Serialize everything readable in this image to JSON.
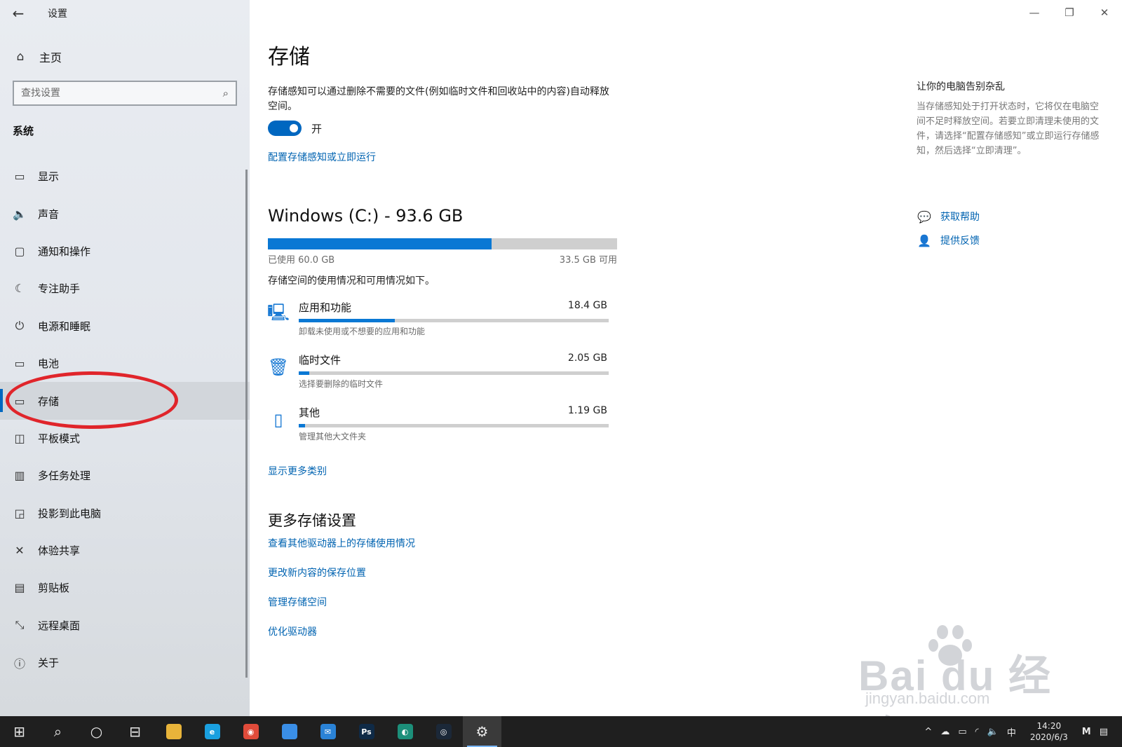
{
  "window": {
    "back_glyph": "←",
    "title": "设置",
    "controls": {
      "minimize": "—",
      "restore": "❐",
      "close": "✕"
    }
  },
  "sidebar": {
    "home_label": "主页",
    "search_placeholder": "查找设置",
    "section": "系统",
    "items": [
      {
        "label": "显示",
        "icon": "display-icon",
        "glyph": "▭"
      },
      {
        "label": "声音",
        "icon": "speaker-icon",
        "glyph": "🔈"
      },
      {
        "label": "通知和操作",
        "icon": "notification-icon",
        "glyph": "▢"
      },
      {
        "label": "专注助手",
        "icon": "moon-icon",
        "glyph": "☾"
      },
      {
        "label": "电源和睡眠",
        "icon": "power-icon",
        "glyph": "⏻"
      },
      {
        "label": "电池",
        "icon": "battery-icon",
        "glyph": "▭"
      },
      {
        "label": "存储",
        "icon": "storage-icon",
        "glyph": "▭"
      },
      {
        "label": "平板模式",
        "icon": "tablet-icon",
        "glyph": "◫"
      },
      {
        "label": "多任务处理",
        "icon": "multitask-icon",
        "glyph": "▥"
      },
      {
        "label": "投影到此电脑",
        "icon": "project-icon",
        "glyph": "◲"
      },
      {
        "label": "体验共享",
        "icon": "share-icon",
        "glyph": "✕"
      },
      {
        "label": "剪贴板",
        "icon": "clipboard-icon",
        "glyph": "▤"
      },
      {
        "label": "远程桌面",
        "icon": "remote-icon",
        "glyph": "⤡"
      },
      {
        "label": "关于",
        "icon": "info-icon",
        "glyph": "ⓘ"
      }
    ],
    "active_index": 6
  },
  "main": {
    "title": "存储",
    "sense_description": "存储感知可以通过删除不需要的文件(例如临时文件和回收站中的内容)自动释放空间。",
    "toggle_label": "开",
    "toggle_on": true,
    "config_link": "配置存储感知或立即运行",
    "drive": {
      "title": "Windows (C:) - 93.6 GB",
      "used_label": "已使用 60.0 GB",
      "free_label": "33.5 GB 可用",
      "used_fraction": 0.641
    },
    "usage_intro": "存储空间的使用情况和可用情况如下。",
    "categories": [
      {
        "name": "应用和功能",
        "size": "18.4 GB",
        "desc": "卸载未使用或不想要的应用和功能",
        "icon": "monitor-icon",
        "glyph": "🖳",
        "fraction": 0.31
      },
      {
        "name": "临时文件",
        "size": "2.05 GB",
        "desc": "选择要删除的临时文件",
        "icon": "trash-icon",
        "glyph": "🗑",
        "fraction": 0.035
      },
      {
        "name": "其他",
        "size": "1.19 GB",
        "desc": "管理其他大文件夹",
        "icon": "folder-icon",
        "glyph": "▯",
        "fraction": 0.02
      }
    ],
    "show_more": "显示更多类别",
    "more_settings_title": "更多存储设置",
    "more_links": [
      "查看其他驱动器上的存储使用情况",
      "更改新内容的保存位置",
      "管理存储空间",
      "优化驱动器"
    ]
  },
  "side_panel": {
    "title": "让你的电脑告别杂乱",
    "description": "当存储感知处于打开状态时，它将仅在电脑空间不足时释放空间。若要立即清理未使用的文件，请选择“配置存储感知”或立即运行存储感知，然后选择“立即清理”。",
    "help_link": "获取帮助",
    "feedback_link": "提供反馈"
  },
  "watermark": {
    "logo": "Bai  du 经验",
    "url": "jingyan.baidu.com"
  },
  "taskbar": {
    "apps": [
      {
        "name": "start-button",
        "glyph": "⊞"
      },
      {
        "name": "search-icon",
        "glyph": "⌕"
      },
      {
        "name": "cortana-icon",
        "glyph": "○"
      },
      {
        "name": "task-view-icon",
        "glyph": "⊟"
      },
      {
        "name": "file-explorer-icon",
        "glyph": "",
        "color": "#e8b43a"
      },
      {
        "name": "edge-icon",
        "glyph": "e",
        "color": "#1aa0e0"
      },
      {
        "name": "chrome-icon",
        "glyph": "◉",
        "color": "#e04b3a"
      },
      {
        "name": "store-icon",
        "glyph": "",
        "color": "#3a8ee6"
      },
      {
        "name": "mail-icon",
        "glyph": "✉",
        "color": "#2a82d6"
      },
      {
        "name": "photoshop-icon",
        "glyph": "Ps",
        "color": "#0f2a46"
      },
      {
        "name": "browser-icon",
        "glyph": "◐",
        "color": "#1c8f7a"
      },
      {
        "name": "steam-icon",
        "glyph": "◎",
        "color": "#1b2838"
      },
      {
        "name": "settings-icon",
        "glyph": "⚙"
      }
    ],
    "active_index": 12,
    "tray": {
      "chevron": "^",
      "ime": "中",
      "time": "14:20",
      "date": "2020/6/3",
      "notification_glyph": "▤"
    }
  },
  "colors": {
    "accent": "#0067c0",
    "bar_fill": "#0a78d4",
    "link": "#0063b1",
    "highlight": "#e0252b"
  }
}
